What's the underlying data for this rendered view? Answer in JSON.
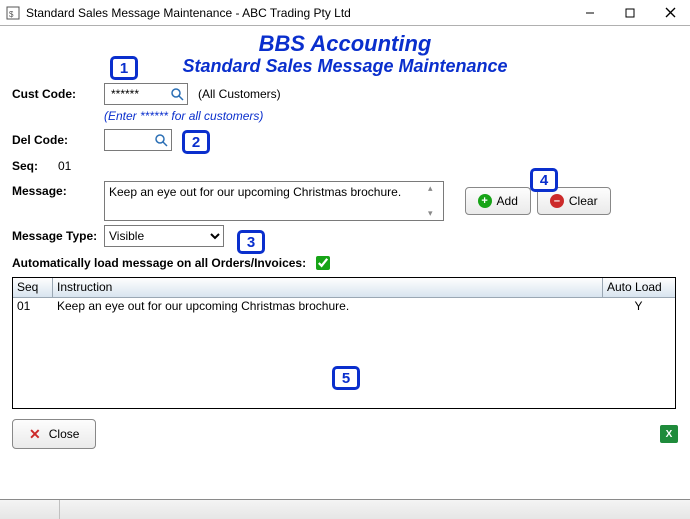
{
  "window": {
    "title": "Standard Sales Message Maintenance - ABC Trading Pty Ltd"
  },
  "headings": {
    "h1": "BBS Accounting",
    "h2": "Standard Sales Message Maintenance"
  },
  "labels": {
    "cust_code": "Cust Code:",
    "del_code": "Del Code:",
    "seq": "Seq:",
    "message": "Message:",
    "message_type": "Message Type:",
    "auto_load": "Automatically load message on all Orders/Invoices:"
  },
  "values": {
    "cust_code": "******",
    "cust_code_side": "(All Customers)",
    "cust_code_hint": "(Enter ****** for all customers)",
    "del_code": "",
    "seq": "01",
    "message": "Keep an eye out for our upcoming Christmas brochure.",
    "message_type_selected": "Visible",
    "auto_load_checked": true
  },
  "options": {
    "message_type": [
      "Visible"
    ]
  },
  "buttons": {
    "add": "Add",
    "clear": "Clear",
    "close": "Close"
  },
  "grid": {
    "headers": {
      "seq": "Seq",
      "instruction": "Instruction",
      "auto_load": "Auto Load"
    },
    "rows": [
      {
        "seq": "01",
        "instruction": "Keep an eye out for our upcoming Christmas brochure.",
        "auto_load": "Y"
      }
    ]
  },
  "callouts": {
    "c1": "1",
    "c2": "2",
    "c3": "3",
    "c4": "4",
    "c5": "5"
  }
}
